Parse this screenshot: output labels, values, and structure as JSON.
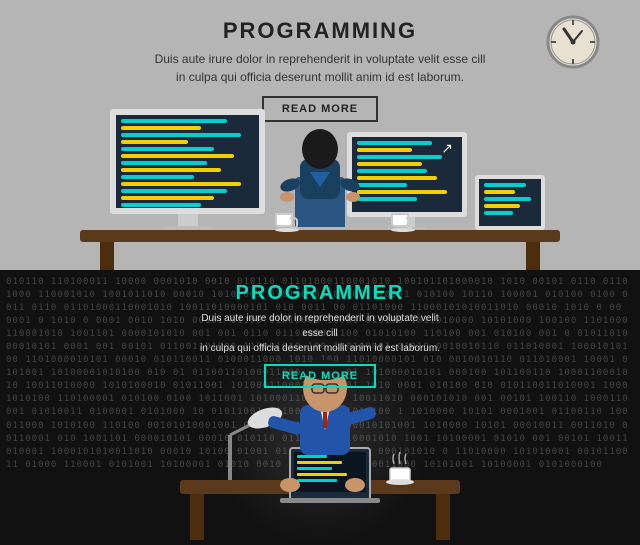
{
  "top": {
    "title": "PROGRAMMING",
    "subtitle_line1": "Duis aute irure dolor in reprehenderit in voluptate velit esse cill",
    "subtitle_line2": "in culpa qui officia deserunt mollit anim id est laborum.",
    "read_more": "READ MORE"
  },
  "bottom": {
    "title": "PROGRAMMER",
    "subtitle_line1": "Duis aute irure dolor in reprehenderit in voluptate velit esse cill",
    "subtitle_line2": "in culpa qui officia deserunt mollit anim id est laborum.",
    "read_more": "READ MORE"
  },
  "colors": {
    "accent": "#00e0c0",
    "bg_top": "#b5b5b5",
    "bg_bottom": "#111111"
  },
  "binary_text": "010110 110100011 10000 0001010 0010 010110 01101000110001010 100101101000010 1010 00101 0110 01101000 110001010 1001011010 00010 1010 001 010110 01101000 110001 010100 10110 100001 010100 0100 0011 0110 01101000110001010 10011010000101 010 0011 00 01101000 11000101010011010 00010 1010 0 00 0001 0 1010 0 0001 0010 1010 00101 01100 11010001 10001 010100 1011010000 10101000 100100 1101000110001010 1001101 0000101010 001 001 0110 01101000 1100 01010100 110100 001 010100 001 0 01011010 00010101 0001 001 00101 011001101000 110001010 100 110100001 01010 0010010110 011010001 10001010100 1101000010101 00010 010110011 0100011000 1010 100 11010000101 010 0010010110 011010001 10001 0101001 10100001010100 010 01 01100110100011000 10101001 101000010101 000100 101100110 1000110001010 10011010000 1010100010 01011001 10100011000101 01001 1010 0001 010100 010 010110011010001 10001010100 110100001 010100 0100 1011001 101000110001010 10011010 000101010 001 00101 100110 1000110001 01010011 0100001 0101000 10 01011001 10100011 0001010100 1 1010000 10101 0001001 01100110 100011000 1010100 110100 00101010001001 011001 101000 1100010101001 1010000 10101 00010011 0011010 00110001 010 1001101 000010101 00010 010110 011010001 10001010 1001 10100001 01010 001 00101 10011010001 1000101010011010 00010 10100 01001 01100 110100011 000101010 0 11010000 101010001 0010110011 01000 110001 0101001 10100001 01010 0010 010110011 0100011000 10101001 10100001 0101000100"
}
